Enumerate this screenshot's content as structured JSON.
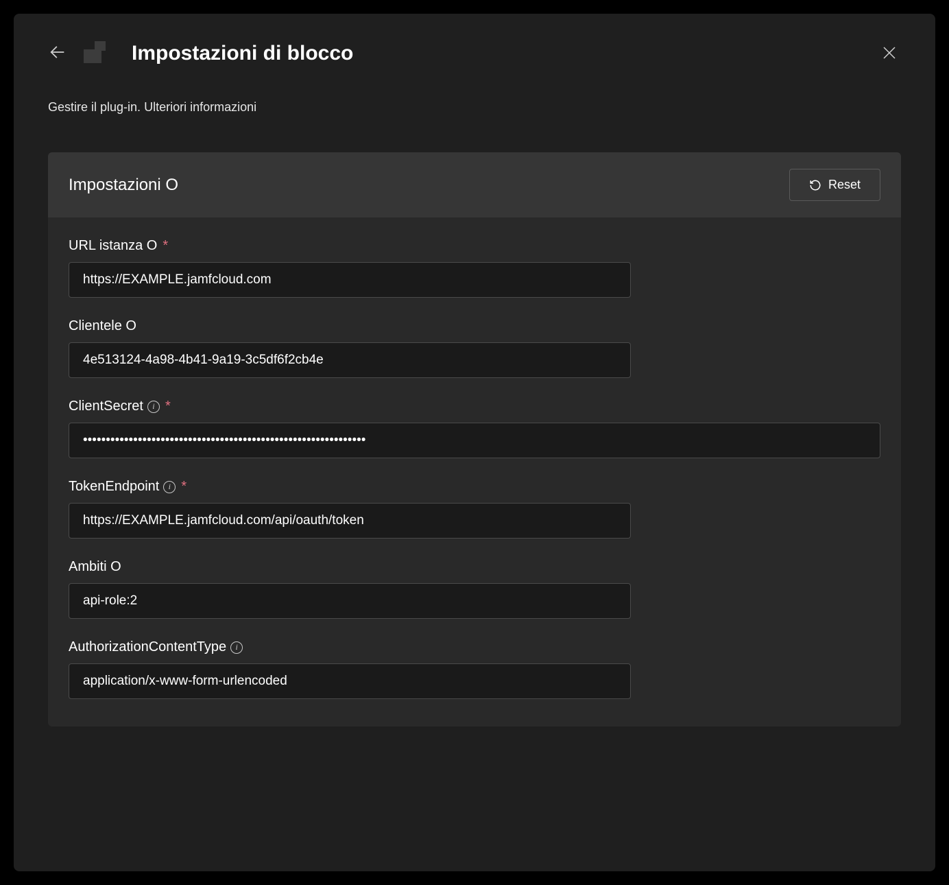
{
  "header": {
    "title": "Impostazioni di blocco"
  },
  "subtitle": {
    "manage": "Gestire il plug-in.",
    "learn_more": "Ulteriori informazioni"
  },
  "card": {
    "title": "Impostazioni O",
    "reset_label": "Reset"
  },
  "fields": {
    "instance_url": {
      "label": "URL istanza O",
      "value": "https://EXAMPLE.jamfcloud.com"
    },
    "client_id": {
      "label": "Clientele O",
      "value": "4e513124-4a98-4b41-9a19-3c5df6f2cb4e"
    },
    "client_secret": {
      "label": "ClientSecret",
      "value": "••••••••••••••••••••••••••••••••••••••••••••••••••••••••••••••"
    },
    "token_endpoint": {
      "label": "TokenEndpoint",
      "value": "https://EXAMPLE.jamfcloud.com/api/oauth/token"
    },
    "scopes": {
      "label": "Ambiti O",
      "value": "api-role:2"
    },
    "auth_content_type": {
      "label": "AuthorizationContentType",
      "value": "application/x-www-form-urlencoded"
    }
  }
}
